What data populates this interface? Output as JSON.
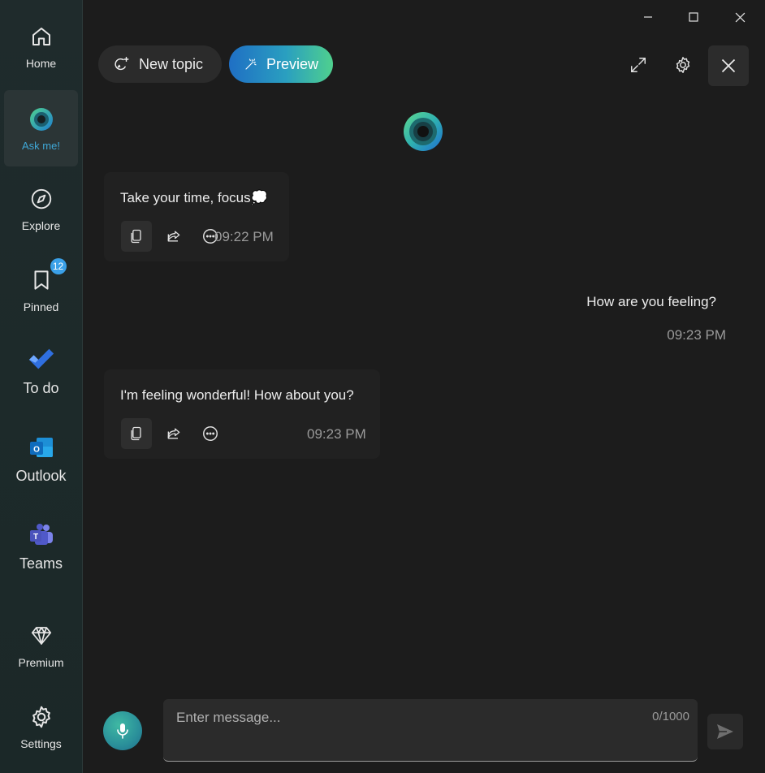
{
  "sidebar": {
    "items": [
      {
        "label": "Home",
        "icon": "home-icon"
      },
      {
        "label": "Ask me!",
        "icon": "ask-orb-icon",
        "active": true
      },
      {
        "label": "Explore",
        "icon": "compass-icon"
      },
      {
        "label": "Pinned",
        "icon": "bookmark-icon",
        "badge": "12"
      },
      {
        "label": "To do",
        "icon": "todo-check-icon"
      },
      {
        "label": "Outlook",
        "icon": "outlook-icon"
      },
      {
        "label": "Teams",
        "icon": "teams-icon"
      },
      {
        "label": "Premium",
        "icon": "diamond-icon"
      },
      {
        "label": "Settings",
        "icon": "gear-icon"
      }
    ]
  },
  "header": {
    "new_topic_label": "New topic",
    "preview_label": "Preview"
  },
  "chat": {
    "messages": [
      {
        "from": "assistant",
        "text": "Take your time, focus💭",
        "time": "09:22 PM"
      },
      {
        "from": "user",
        "text": "How are you feeling?",
        "time": "09:23 PM"
      },
      {
        "from": "assistant",
        "text": "I'm feeling wonderful! How about you?",
        "time": "09:23 PM"
      }
    ]
  },
  "input": {
    "placeholder": "Enter message...",
    "counter": "0/1000"
  },
  "colors": {
    "accent_blue": "#3fa7d6",
    "accent_teal": "#3fc7b0",
    "badge": "#3aa0e8",
    "background": "#1c1c1c"
  }
}
